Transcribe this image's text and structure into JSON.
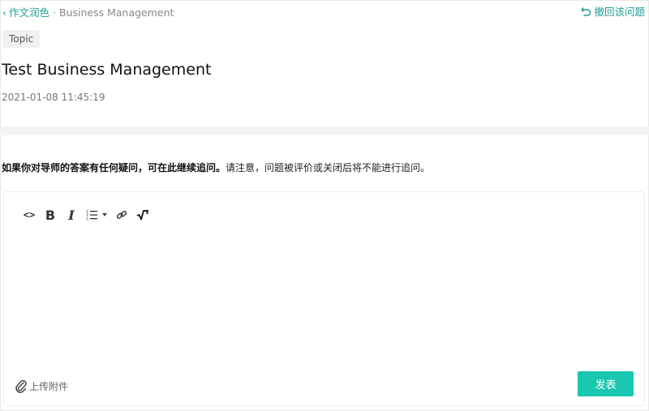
{
  "breadcrumb": {
    "back_glyph": "‹",
    "parent": "作文润色",
    "separator": "·",
    "current": "Business Management"
  },
  "header_actions": {
    "withdraw_label": "撤回该问题",
    "withdraw_icon": "undo-icon"
  },
  "question": {
    "tag": "Topic",
    "title": "Test Business Management",
    "timestamp": "2021-01-08 11:45:19"
  },
  "notice": {
    "bold_part": "如果你对导师的答案有任何疑问，可在此继续追问。",
    "normal_part": "请注意，问题被评价或关闭后将不能进行追问。"
  },
  "editor": {
    "toolbar": [
      {
        "name": "code-view-button",
        "icon": "code-icon",
        "glyph": "<>"
      },
      {
        "name": "bold-button",
        "icon": "bold-icon",
        "glyph": "B"
      },
      {
        "name": "italic-button",
        "icon": "italic-icon",
        "glyph": "I"
      },
      {
        "name": "ordered-list-button",
        "icon": "ordered-list-icon",
        "glyph": ""
      },
      {
        "name": "link-button",
        "icon": "link-icon",
        "glyph": ""
      },
      {
        "name": "formula-button",
        "icon": "square-root-icon",
        "glyph": ""
      }
    ],
    "upload_label": "上传附件",
    "upload_icon": "paperclip-icon",
    "submit_label": "发表"
  },
  "colors": {
    "accent": "#1f9e96",
    "submit_bg": "#19c7b0",
    "band": "#f3f3f3"
  }
}
